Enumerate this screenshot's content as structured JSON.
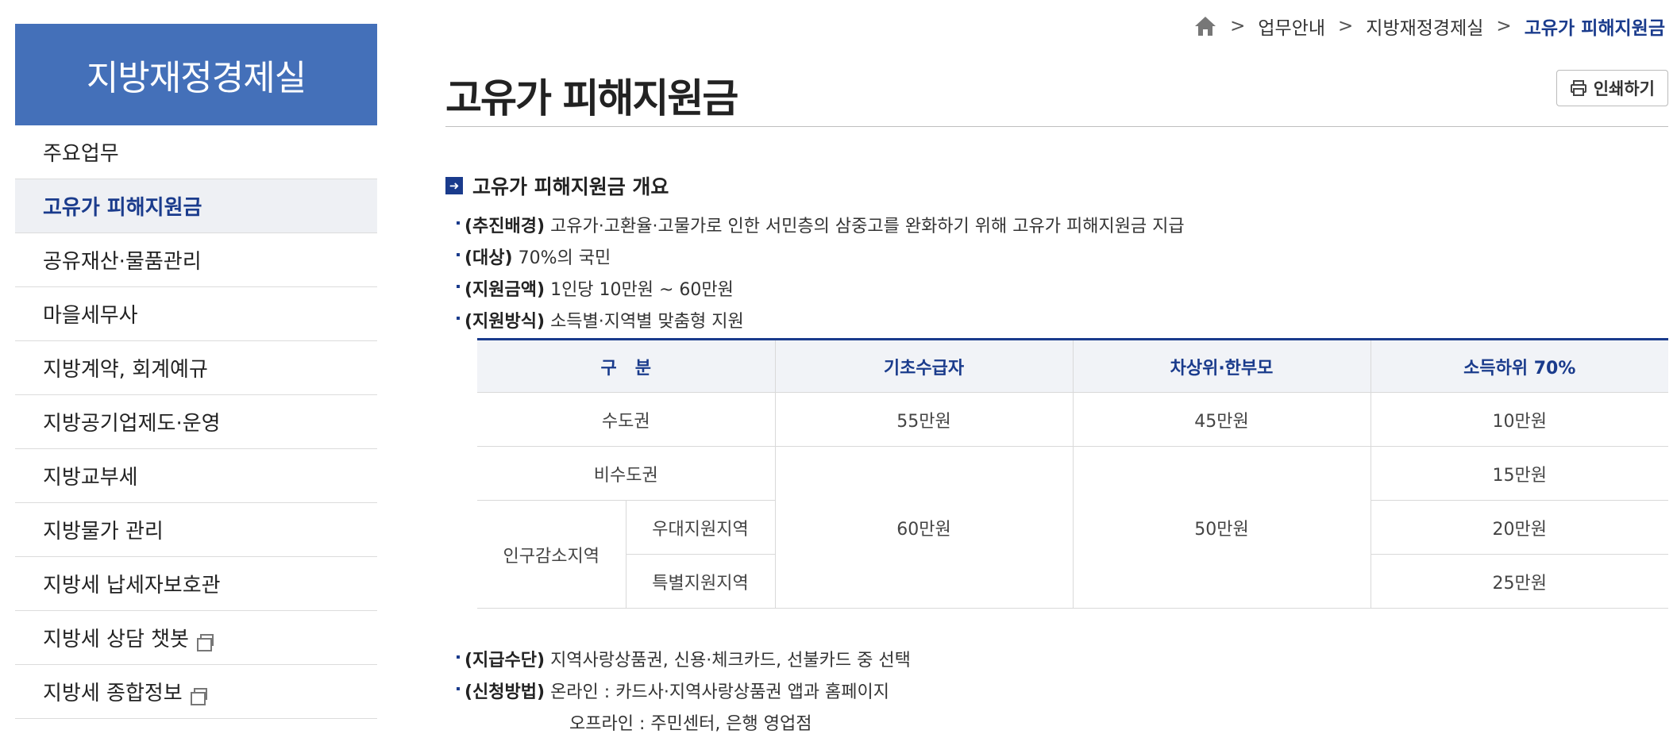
{
  "sidebar": {
    "title": "지방재정경제실",
    "items": [
      {
        "label": "주요업무"
      },
      {
        "label": "고유가 피해지원금"
      },
      {
        "label": "공유재산·물품관리"
      },
      {
        "label": "마을세무사"
      },
      {
        "label": "지방계약, 회계예규"
      },
      {
        "label": "지방공기업제도·운영"
      },
      {
        "label": "지방교부세"
      },
      {
        "label": "지방물가 관리"
      },
      {
        "label": "지방세 납세자보호관"
      },
      {
        "label": "지방세 상담 챗봇"
      },
      {
        "label": "지방세 종합정보"
      }
    ]
  },
  "breadcrumb": {
    "sep": ">",
    "items": [
      "업무안내",
      "지방재정경제실",
      "고유가 피해지원금"
    ]
  },
  "page": {
    "title": "고유가 피해지원금",
    "print_label": "인쇄하기"
  },
  "section": {
    "title": "고유가 피해지원금 개요",
    "bullets": [
      {
        "label": "(추진배경)",
        "text": " 고유가·고환율·고물가로 인한 서민층의 삼중고를 완화하기 위해 고유가 피해지원금 지급"
      },
      {
        "label": "(대상)",
        "text": " 70%의 국민"
      },
      {
        "label": "(지원금액)",
        "text": " 1인당 10만원 ~ 60만원"
      },
      {
        "label": "(지원방식)",
        "text": " 소득별·지역별 맞춤형 지원"
      },
      {
        "label": "(지급수단)",
        "text": " 지역사랑상품권, 신용·체크카드, 선불카드 중 선택"
      },
      {
        "label": "(신청방법)",
        "text": " 온라인 : 카드사·지역사랑상품권 앱과 홈페이지"
      }
    ],
    "offline_line": "오프라인 : 주민센터, 은행 영업점"
  },
  "table": {
    "headers": [
      "구   분",
      "기초수급자",
      "차상위·한부모",
      "소득하위 70%"
    ],
    "capital": "수도권",
    "non_capital": "비수도권",
    "decline": "인구감소지역",
    "decline_sub1": "우대지원지역",
    "decline_sub2": "특별지원지역",
    "basic_capital": "55만원",
    "basic_other": "60만원",
    "near_capital": "45만원",
    "near_other": "50만원",
    "low_capital": "10만원",
    "low_non_capital": "15만원",
    "low_sub1": "20만원",
    "low_sub2": "25만원"
  }
}
